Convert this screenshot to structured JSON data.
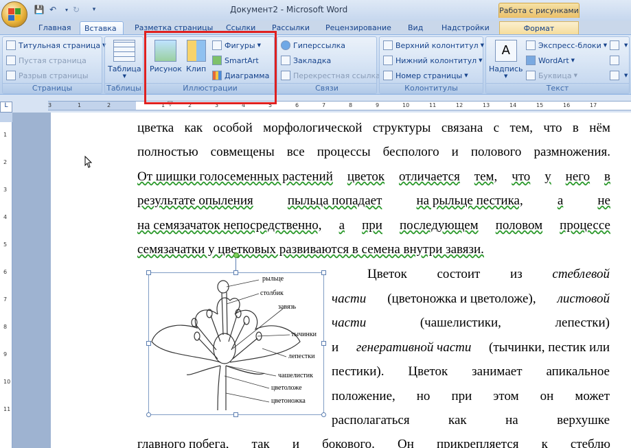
{
  "window": {
    "title": "Документ2 - Microsoft Word",
    "context_tools": "Работа с рисунками"
  },
  "tabs": [
    "Главная",
    "Вставка",
    "Разметка страницы",
    "Ссылки",
    "Рассылки",
    "Рецензирование",
    "Вид",
    "Надстройки",
    "Формат"
  ],
  "active_tab": "Вставка",
  "ribbon": {
    "pages": {
      "label": "Страницы",
      "items": [
        "Титульная страница",
        "Пустая страница",
        "Разрыв страницы"
      ]
    },
    "tables": {
      "label": "Таблицы",
      "table": "Таблица"
    },
    "illustrations": {
      "label": "Иллюстрации",
      "picture": "Рисунок",
      "clip": "Клип",
      "shapes": "Фигуры",
      "smartart": "SmartArt",
      "chart": "Диаграмма"
    },
    "links": {
      "label": "Связи",
      "hyperlink": "Гиперссылка",
      "bookmark": "Закладка",
      "cross_ref": "Перекрестная ссылка"
    },
    "header_footer": {
      "label": "Колонтитулы",
      "header": "Верхний колонтитул",
      "footer": "Нижний колонтитул",
      "page_number": "Номер страницы"
    },
    "text": {
      "label": "Текст",
      "textbox": "Надпись",
      "quick_parts": "Экспресс-блоки",
      "wordart": "WordArt",
      "dropcap": "Буквица"
    }
  },
  "ruler": {
    "h": [
      "3",
      "1",
      "2",
      "1",
      "1",
      "2",
      "3",
      "4",
      "5",
      "6",
      "7",
      "8",
      "9",
      "10",
      "11",
      "12",
      "13",
      "14",
      "15",
      "16",
      "17"
    ],
    "v": [
      "1",
      "2",
      "3",
      "4",
      "5",
      "6",
      "7",
      "8",
      "9",
      "10",
      "11"
    ]
  },
  "document": {
    "lines": [
      [
        "цветка",
        "как",
        "особой",
        "морфологической",
        "структуры",
        "связана",
        "с",
        "тем,",
        "что",
        "в",
        "нём"
      ],
      [
        "полностью",
        "совмещены",
        "все",
        "процессы",
        "бесполого",
        "и",
        "полового",
        "размножения."
      ],
      [
        "От шишки голосеменных растений",
        "цветок",
        "отличается",
        "тем,",
        "что",
        "у",
        "него",
        "в"
      ],
      [
        "результате опыления",
        "пыльца попадает",
        "на рыльце пестика,",
        "а",
        "не"
      ],
      [
        "на семязачаток непосредственно,",
        "а",
        "при",
        "последующем",
        "половом",
        "процессе"
      ],
      [
        "семязачатки у цветковых развиваются в семена внутри завязи."
      ]
    ],
    "right_lines": [
      {
        "parts": [
          "Цветок",
          "состоит",
          "из",
          "стеблевой"
        ],
        "italic": [
          false,
          false,
          false,
          true
        ]
      },
      {
        "parts": [
          "части",
          "(цветоножка и цветоложе),",
          "листовой"
        ],
        "italic": [
          true,
          false,
          true
        ]
      },
      {
        "parts": [
          "части",
          "(чашелистики,",
          "лепестки)"
        ],
        "italic": [
          true,
          false,
          false
        ]
      },
      {
        "parts": [
          "и",
          "генеративной части",
          "(тычинки, пестик или"
        ],
        "italic": [
          false,
          true,
          false
        ]
      },
      {
        "parts": [
          "пестики).",
          "Цветок",
          "занимает",
          "апикальное"
        ],
        "italic": [
          false,
          false,
          false,
          false
        ]
      },
      {
        "parts": [
          "положение,",
          "но",
          "при",
          "этом",
          "он",
          "может"
        ],
        "italic": [
          false,
          false,
          false,
          false,
          false,
          false
        ]
      },
      {
        "parts": [
          "располагаться",
          "как",
          "на",
          "верхушке"
        ],
        "italic": [
          false,
          false,
          false,
          false
        ]
      }
    ],
    "last_line": [
      "главного побега,",
      "так",
      "и",
      "бокового.",
      "Он",
      "прикрепляется",
      "к",
      "стеблю"
    ]
  },
  "figure_labels": [
    "рыльце",
    "столбик",
    "завязь",
    "тычинки",
    "лепестки",
    "чашелистик",
    "цветоложе",
    "цветоножка"
  ],
  "colors": {
    "highlight": "#e0201f",
    "ribbon": "#c5d8f0",
    "spell_underline": "#2e9a2e"
  }
}
